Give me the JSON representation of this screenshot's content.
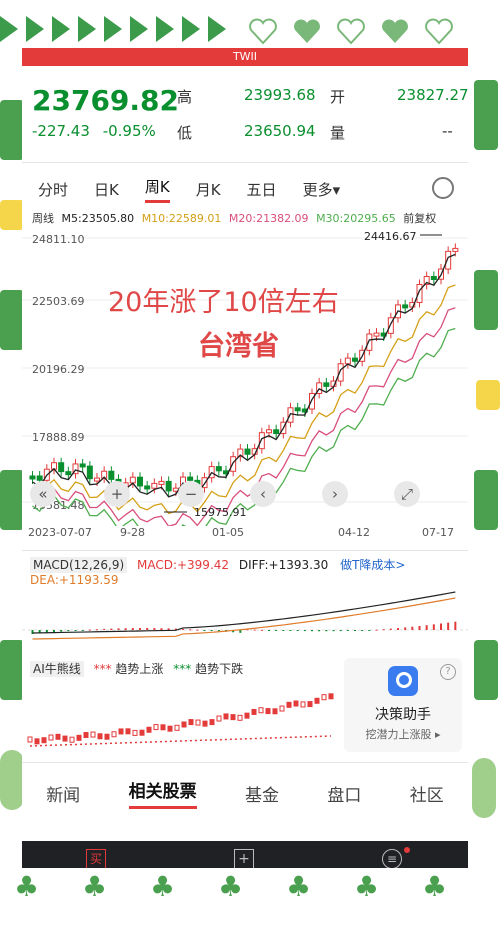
{
  "header": {
    "window_title": "TWII",
    "price": "23769.82",
    "change": "-227.43",
    "change_pct": "-0.95%",
    "high_label": "高",
    "high_value": "23993.68",
    "low_label": "低",
    "low_value": "23650.94",
    "open_label": "开",
    "open_value": "23827.27",
    "volume_label": "量",
    "volume_value": "--"
  },
  "tabs": [
    "分时",
    "日K",
    "周K",
    "月K",
    "五日",
    "更多▾"
  ],
  "active_tab": "周K",
  "ma": {
    "label": "周线",
    "m5": "M5:23505.80",
    "m10": "M10:22589.01",
    "m20": "M20:21382.09",
    "m30": "M30:20295.65",
    "adjust": "前复权"
  },
  "chart": {
    "y_ticks": [
      "24811.10",
      "22503.69",
      "20196.29",
      "17888.89",
      "15581.48"
    ],
    "high_marker": "24416.67",
    "low_marker": "15975.91",
    "x_dates": [
      "2023-07-07",
      "9-28",
      "01-05",
      "04-12",
      "07-17"
    ],
    "overlay_line1": "20年涨了10倍左右",
    "overlay_line2": "台湾省"
  },
  "controls": [
    "«",
    "+",
    "−",
    "‹",
    "›",
    "⤢"
  ],
  "macd": {
    "selector": "MACD(12,26,9)",
    "macd": "MACD:+399.42",
    "diff": "DIFF:+1393.30",
    "dea": "DEA:+1193.59",
    "link": "做T降成本>"
  },
  "ai": {
    "selector": "AI牛熊线",
    "up_legend": "趋势上涨",
    "down_legend": "趋势下跌",
    "assistant_title": "决策助手",
    "assistant_sub": "挖潜力上涨股 ▸",
    "help": "?"
  },
  "bottom_tabs": [
    "新闻",
    "相关股票",
    "基金",
    "盘口",
    "社区"
  ],
  "active_bottom": "相关股票",
  "nav": [
    "买",
    "+",
    "≡"
  ],
  "colors": {
    "up": "#e33a3a",
    "down": "#0a8f2f",
    "accent": "#e33a3a",
    "deco_green": "#3c9a4b"
  },
  "chart_data": {
    "type": "candlestick",
    "title": "",
    "x_dates": [
      "2023-07-07",
      "9-28",
      "01-05",
      "04-12",
      "07-17"
    ],
    "ylim": [
      15581.48,
      24811.1
    ],
    "high": 24416.67,
    "low": 15975.91
  }
}
